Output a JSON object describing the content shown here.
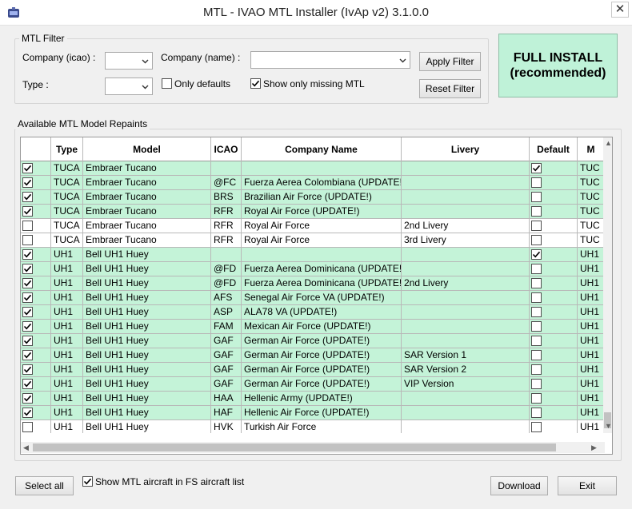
{
  "window": {
    "title": "MTL - IVAO MTL Installer (IvAp v2) 3.1.0.0",
    "close_glyph": "✕"
  },
  "filter": {
    "group_title": "MTL Filter",
    "company_icao_label": "Company (icao) :",
    "company_name_label": "Company (name) :",
    "type_label": "Type :",
    "only_defaults_label": "Only defaults",
    "only_defaults_checked": false,
    "show_missing_label": "Show only missing MTL",
    "show_missing_checked": true,
    "apply_label": "Apply Filter",
    "reset_label": "Reset Filter"
  },
  "full_install": {
    "line1": "FULL INSTALL",
    "line2": "(recommended)"
  },
  "models_group_title": "Available MTL Model Repaints",
  "table": {
    "columns": [
      "",
      "Type",
      "Model",
      "ICAO",
      "Company Name",
      "Livery",
      "Default",
      "M"
    ],
    "rows": [
      {
        "checked": true,
        "type": "TUCA",
        "model": "Embraer Tucano",
        "icao": "",
        "company": "",
        "livery": "",
        "default": true,
        "m": "TUC",
        "missing": true
      },
      {
        "checked": true,
        "type": "TUCA",
        "model": "Embraer Tucano",
        "icao": "@FC",
        "company": "Fuerza Aerea Colombiana (UPDATE!",
        "livery": "",
        "default": false,
        "m": "TUC",
        "missing": true
      },
      {
        "checked": true,
        "type": "TUCA",
        "model": "Embraer Tucano",
        "icao": "BRS",
        "company": "Brazilian Air Force (UPDATE!)",
        "livery": "",
        "default": false,
        "m": "TUC",
        "missing": true
      },
      {
        "checked": true,
        "type": "TUCA",
        "model": "Embraer Tucano",
        "icao": "RFR",
        "company": "Royal Air Force (UPDATE!)",
        "livery": "",
        "default": false,
        "m": "TUC",
        "missing": true
      },
      {
        "checked": false,
        "type": "TUCA",
        "model": "Embraer Tucano",
        "icao": "RFR",
        "company": "Royal Air Force",
        "livery": "2nd Livery",
        "default": false,
        "m": "TUC",
        "missing": false
      },
      {
        "checked": false,
        "type": "TUCA",
        "model": "Embraer Tucano",
        "icao": "RFR",
        "company": "Royal Air Force",
        "livery": "3rd Livery",
        "default": false,
        "m": "TUC",
        "missing": false
      },
      {
        "checked": true,
        "type": "UH1",
        "model": "Bell UH1 Huey",
        "icao": "",
        "company": "",
        "livery": "",
        "default": true,
        "m": "UH1",
        "missing": true
      },
      {
        "checked": true,
        "type": "UH1",
        "model": "Bell UH1 Huey",
        "icao": "@FD",
        "company": "Fuerza Aerea Dominicana (UPDATE!",
        "livery": "",
        "default": false,
        "m": "UH1",
        "missing": true
      },
      {
        "checked": true,
        "type": "UH1",
        "model": "Bell UH1 Huey",
        "icao": "@FD",
        "company": "Fuerza Aerea Dominicana (UPDATE!",
        "livery": "2nd Livery",
        "default": false,
        "m": "UH1",
        "missing": true
      },
      {
        "checked": true,
        "type": "UH1",
        "model": "Bell UH1 Huey",
        "icao": "AFS",
        "company": "Senegal Air Force VA (UPDATE!)",
        "livery": "",
        "default": false,
        "m": "UH1",
        "missing": true
      },
      {
        "checked": true,
        "type": "UH1",
        "model": "Bell UH1 Huey",
        "icao": "ASP",
        "company": "ALA78 VA (UPDATE!)",
        "livery": "",
        "default": false,
        "m": "UH1",
        "missing": true
      },
      {
        "checked": true,
        "type": "UH1",
        "model": "Bell UH1 Huey",
        "icao": "FAM",
        "company": "Mexican Air Force (UPDATE!)",
        "livery": "",
        "default": false,
        "m": "UH1",
        "missing": true
      },
      {
        "checked": true,
        "type": "UH1",
        "model": "Bell UH1 Huey",
        "icao": "GAF",
        "company": "German Air Force (UPDATE!)",
        "livery": "",
        "default": false,
        "m": "UH1",
        "missing": true
      },
      {
        "checked": true,
        "type": "UH1",
        "model": "Bell UH1 Huey",
        "icao": "GAF",
        "company": "German Air Force (UPDATE!)",
        "livery": "SAR Version 1",
        "default": false,
        "m": "UH1",
        "missing": true
      },
      {
        "checked": true,
        "type": "UH1",
        "model": "Bell UH1 Huey",
        "icao": "GAF",
        "company": "German Air Force (UPDATE!)",
        "livery": "SAR Version 2",
        "default": false,
        "m": "UH1",
        "missing": true
      },
      {
        "checked": true,
        "type": "UH1",
        "model": "Bell UH1 Huey",
        "icao": "GAF",
        "company": "German Air Force (UPDATE!)",
        "livery": "VIP Version",
        "default": false,
        "m": "UH1",
        "missing": true
      },
      {
        "checked": true,
        "type": "UH1",
        "model": "Bell UH1 Huey",
        "icao": "HAA",
        "company": "Hellenic Army (UPDATE!)",
        "livery": "",
        "default": false,
        "m": "UH1",
        "missing": true
      },
      {
        "checked": true,
        "type": "UH1",
        "model": "Bell UH1 Huey",
        "icao": "HAF",
        "company": "Hellenic Air Force (UPDATE!)",
        "livery": "",
        "default": false,
        "m": "UH1",
        "missing": true
      },
      {
        "checked": false,
        "type": "UH1",
        "model": "Bell UH1 Huey",
        "icao": "HVK",
        "company": "Turkish Air Force",
        "livery": "",
        "default": false,
        "m": "UH1",
        "missing": false
      }
    ]
  },
  "footer": {
    "select_all_label": "Select all",
    "show_fs_label": "Show MTL aircraft in FS aircraft list",
    "show_fs_checked": true,
    "download_label": "Download",
    "exit_label": "Exit"
  },
  "colors": {
    "missing_row": "#c4f3d8",
    "full_install_bg": "#bff2d8"
  }
}
